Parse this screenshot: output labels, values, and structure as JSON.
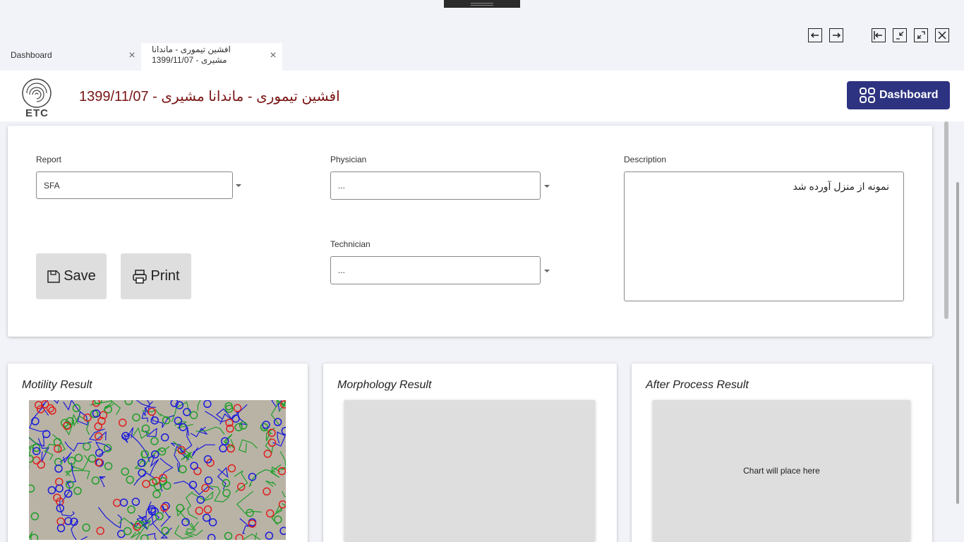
{
  "window": {
    "controls": [
      "back-icon",
      "forward-icon",
      "dock-icon",
      "restore-icon",
      "maximize-icon",
      "close-icon"
    ]
  },
  "tabs": [
    {
      "label": "Dashboard",
      "active": false
    },
    {
      "label": "افشین تیموری - ماندانا مشیری - 1399/11/07",
      "active": true
    }
  ],
  "header": {
    "logo_text": "ETC",
    "title": "1399/11/07 - افشین تیموری - ماندانا مشیری",
    "dashboard_button": "Dashboard"
  },
  "form": {
    "report": {
      "label": "Report",
      "value": "SFA"
    },
    "physician": {
      "label": "Physician",
      "value": "..."
    },
    "technician": {
      "label": "Technician",
      "value": "..."
    },
    "description": {
      "label": "Description",
      "value": "نمونه از منزل آورده شد"
    },
    "save_label": "Save",
    "print_label": "Print"
  },
  "results": {
    "motility": {
      "title": "Motility Result"
    },
    "morphology": {
      "title": "Morphology Result"
    },
    "after_process": {
      "title": "After Process Result",
      "placeholder": "Chart will place here"
    }
  },
  "colors": {
    "accent": "#2d3380",
    "title": "#7a1414",
    "motile": "#1f9e2a",
    "progressive": "#1a1adb",
    "immotile": "#e02020"
  }
}
